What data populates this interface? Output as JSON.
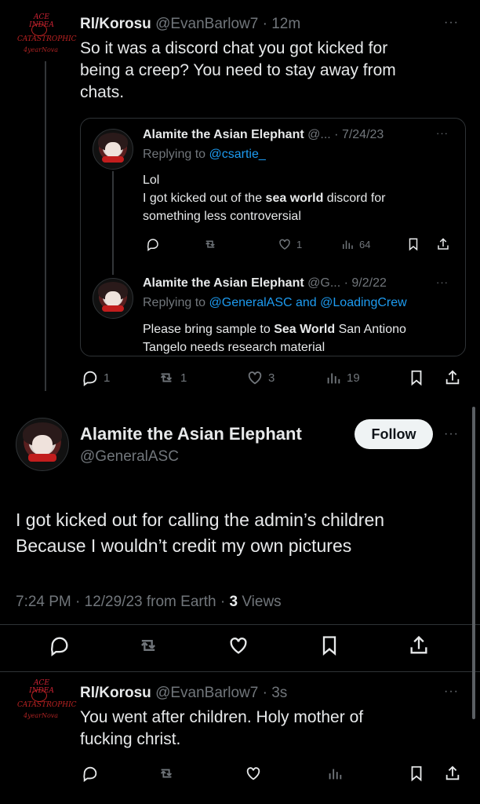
{
  "colors": {
    "background": "#000000",
    "text": "#e7e9ea",
    "muted": "#71767b",
    "link": "#1d9bf0",
    "follow_bg": "#eff3f4"
  },
  "tweet1": {
    "avatar_text": [
      "ACE INDEA",
      "CATASTROPHIC",
      "4yearNova"
    ],
    "name": "Rl/Korosu",
    "handle": "@EvanBarlow7",
    "sep": "·",
    "time": "12m",
    "more": "···",
    "text_lines": [
      "So it was a discord chat you got kicked for",
      "being a creep? You need to stay away from",
      "chats."
    ],
    "actions": {
      "reply": "1",
      "retweet": "1",
      "like": "3",
      "views": "19"
    }
  },
  "quote1": {
    "name": "Alamite the Asian Elephant",
    "handle": "@...",
    "sep": "·",
    "time": "7/24/23",
    "more": "···",
    "replying_prefix": "Replying to",
    "replying_to": "@csartie_",
    "line1": "Lol",
    "line2_pre": "I got kicked out of the ",
    "line2_bold": "sea world",
    "line2_post": " discord for",
    "line3": "something less controversial",
    "actions": {
      "like": "1",
      "views": "64"
    }
  },
  "quote2": {
    "name": "Alamite the Asian Elephant",
    "handle": "@G...",
    "sep": "·",
    "time": "9/2/22",
    "more": "···",
    "replying_prefix": "Replying to",
    "replying_to": "@GeneralASC and @LoadingCrew",
    "line1_pre": "Please bring sample to ",
    "line1_bold": "Sea World",
    "line1_post": " San Antiono",
    "line2": "Tangelo needs research material"
  },
  "main_tweet": {
    "name": "Alamite the Asian Elephant",
    "handle": "@GeneralASC",
    "follow_label": "Follow",
    "more": "···",
    "text_lines": [
      "I got kicked out for calling the admin’s children",
      "Because I wouldn’t credit my own pictures"
    ],
    "meta_prefix": "7:24 PM · 12/29/23 from Earth · ",
    "views_count": "3",
    "views_label": " Views"
  },
  "tweet3": {
    "avatar_text": [
      "ACE INDEA",
      "CATASTROPHIC",
      "4yearNova"
    ],
    "name": "Rl/Korosu",
    "handle": "@EvanBarlow7",
    "sep": "·",
    "time": "3s",
    "more": "···",
    "text_lines": [
      "You went after children. Holy mother of",
      "fucking christ."
    ]
  }
}
